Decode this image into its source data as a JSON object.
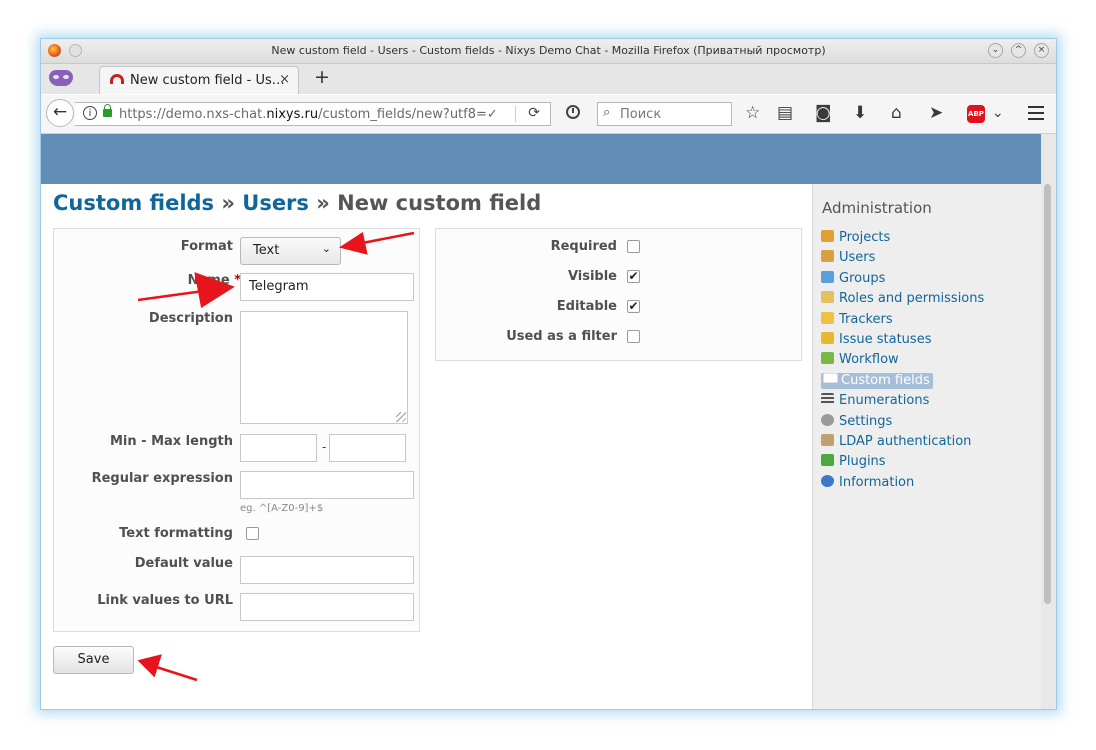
{
  "window": {
    "title": "New custom field - Users - Custom fields - Nixys Demo Chat - Mozilla Firefox (Приватный просмотр)",
    "buttons": [
      "⌄",
      "^",
      "×"
    ]
  },
  "tab": {
    "title": "New custom field - Us…",
    "close": "×",
    "new_tab": "+"
  },
  "nav": {
    "back": "←",
    "url_prefix": "https://demo.nxs-chat.",
    "url_domain": "nixys.ru",
    "url_suffix": "/custom_fields/new?utf8=✓",
    "reload": "⟳",
    "search_placeholder": "Поиск",
    "search_icon": "⌕",
    "icons": {
      "bookmark": "☆",
      "reader": "▤",
      "pocket": "◙",
      "download": "⬇",
      "home": "⌂",
      "send": "➤",
      "abp": "ABP",
      "abp_dropdown": "⌄"
    }
  },
  "page": {
    "breadcrumb": {
      "custom_fields": "Custom fields",
      "sep1": " » ",
      "users": "Users",
      "sep2": " » ",
      "current": "New custom field"
    }
  },
  "form": {
    "format": {
      "label": "Format",
      "value": "Text",
      "chevron": "⌄"
    },
    "name": {
      "label": "Name",
      "required_mark": "*",
      "value": "Telegram"
    },
    "description": {
      "label": "Description",
      "value": ""
    },
    "min_max": {
      "label": "Min - Max length",
      "separator": "-",
      "min": "",
      "max": ""
    },
    "regexp": {
      "label": "Regular expression",
      "value": "",
      "hint": "eg. ^[A-Z0-9]+$"
    },
    "text_formatting": {
      "label": "Text formatting",
      "checked": false
    },
    "default_value": {
      "label": "Default value",
      "value": ""
    },
    "link_url": {
      "label": "Link values to URL",
      "value": ""
    }
  },
  "options": {
    "required": {
      "label": "Required",
      "mark": ""
    },
    "visible": {
      "label": "Visible",
      "mark": "✔"
    },
    "editable": {
      "label": "Editable",
      "mark": "✔"
    },
    "filter": {
      "label": "Used as a filter",
      "mark": ""
    }
  },
  "actions": {
    "save": "Save"
  },
  "sidebar": {
    "title": "Administration",
    "items": [
      {
        "label": "Projects",
        "color": "#e0a030"
      },
      {
        "label": "Users",
        "color": "#d8a040"
      },
      {
        "label": "Groups",
        "color": "#5aa0d8"
      },
      {
        "label": "Roles and permissions",
        "color": "#e6c060"
      },
      {
        "label": "Trackers",
        "color": "#f0c040"
      },
      {
        "label": "Issue statuses",
        "color": "#e8b830"
      },
      {
        "label": "Workflow",
        "color": "#7ab648"
      },
      {
        "label": "Custom fields",
        "color": "#ffffff"
      },
      {
        "label": "Enumerations",
        "color": "#555555"
      },
      {
        "label": "Settings",
        "color": "#9a9a9a"
      },
      {
        "label": "LDAP authentication",
        "color": "#c0a070"
      },
      {
        "label": "Plugins",
        "color": "#4aaa3a"
      },
      {
        "label": "Information",
        "color": "#3a78c8"
      }
    ]
  },
  "colors": {
    "header": "#628db6",
    "link": "#116699",
    "annotation_arrow": "#e8141c"
  }
}
